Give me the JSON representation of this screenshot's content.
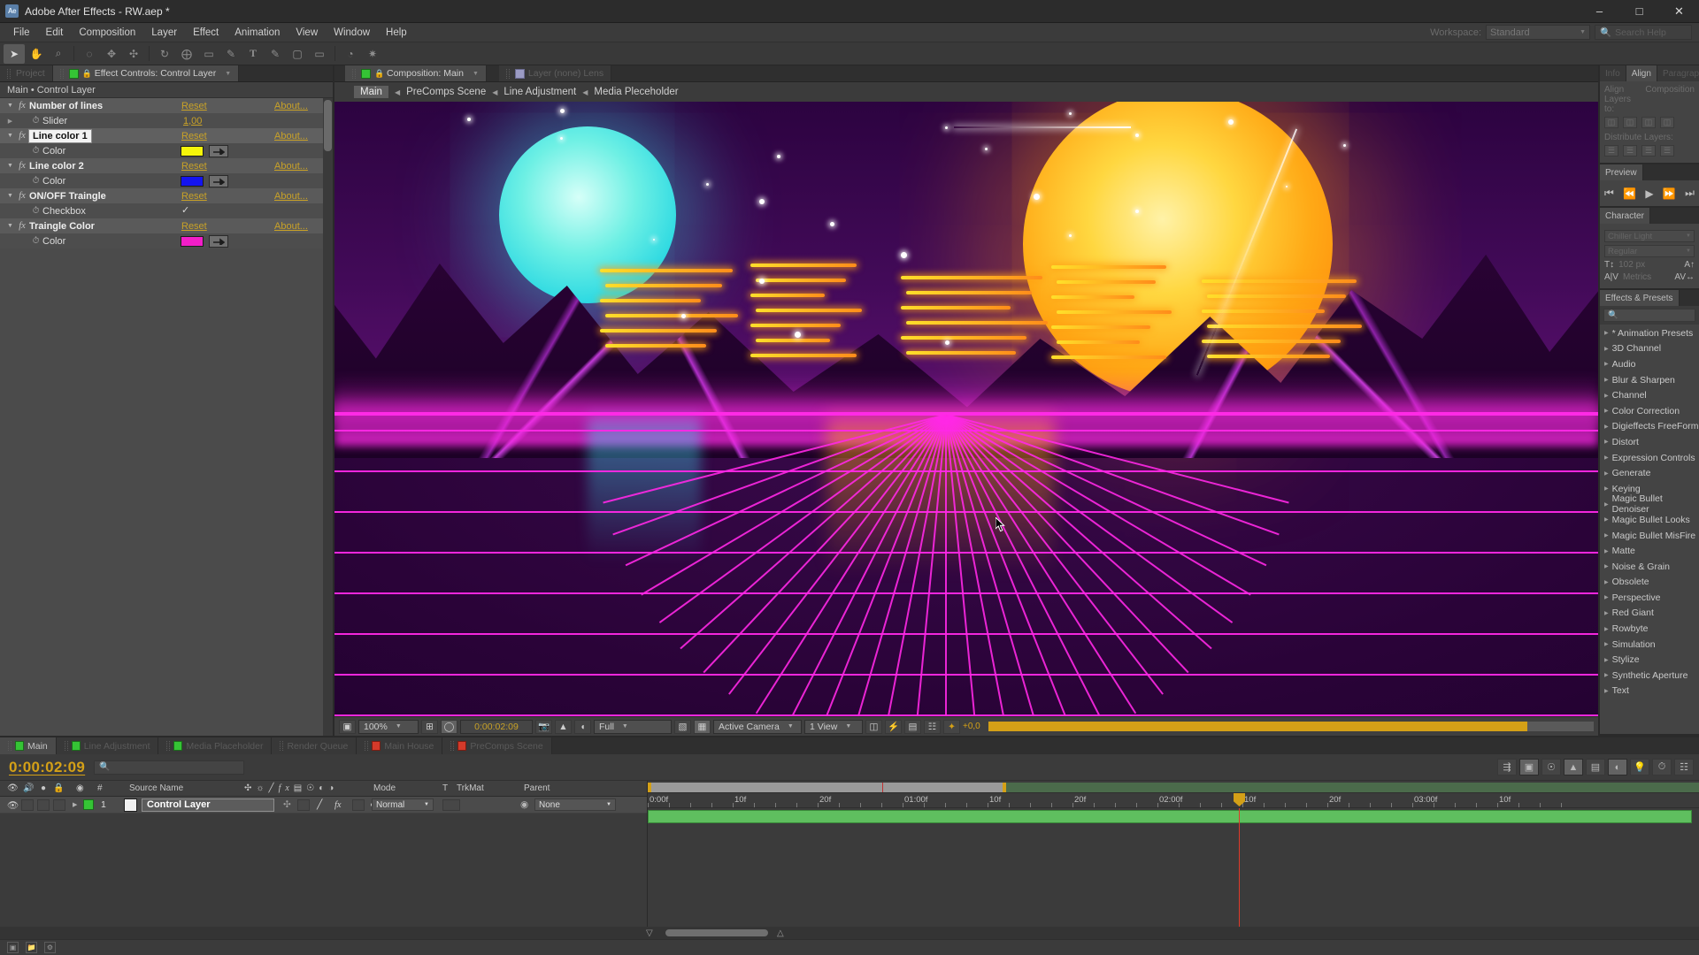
{
  "window": {
    "app_icon": "ae-logo-icon",
    "title": "Adobe After Effects - RW.aep *",
    "minimize": "–",
    "maximize": "□",
    "close": "✕"
  },
  "menu": {
    "items": [
      "File",
      "Edit",
      "Composition",
      "Layer",
      "Effect",
      "Animation",
      "View",
      "Window",
      "Help"
    ],
    "workspace_label": "Workspace:",
    "workspace_value": "Standard",
    "search_placeholder": "Search Help"
  },
  "toolbar": {
    "tools": [
      {
        "name": "selection-tool",
        "glyph": "➤",
        "active": true
      },
      {
        "name": "hand-tool",
        "glyph": "✋",
        "active": false
      },
      {
        "name": "zoom-tool",
        "glyph": "⌕",
        "active": false
      },
      {
        "name": "orbit-camera-tool",
        "glyph": "◌",
        "active": false
      },
      {
        "name": "track-xy-camera-tool",
        "glyph": "✥",
        "active": false
      },
      {
        "name": "track-z-camera-tool",
        "glyph": "✣",
        "active": false
      },
      {
        "name": "rotation-tool",
        "glyph": "↻",
        "active": false
      },
      {
        "name": "anchor-point-tool",
        "glyph": "⨁",
        "active": false
      },
      {
        "name": "shape-tool",
        "glyph": "□",
        "active": false
      },
      {
        "name": "pen-tool",
        "glyph": "✒",
        "active": false
      },
      {
        "name": "type-tool",
        "glyph": "T",
        "active": false
      },
      {
        "name": "brush-tool",
        "glyph": "✎",
        "active": false
      },
      {
        "name": "clone-stamp-tool",
        "glyph": "☂",
        "active": false
      },
      {
        "name": "eraser-tool",
        "glyph": "▭",
        "active": false
      },
      {
        "name": "roto-brush-tool",
        "glyph": "◔",
        "active": false
      },
      {
        "name": "puppet-pin-tool",
        "glyph": "★",
        "active": false
      }
    ]
  },
  "effect_controls": {
    "tabs": [
      {
        "label": "Project",
        "active": false,
        "icon": "none"
      },
      {
        "label": "Effect Controls: Control Layer",
        "active": true,
        "icon": "comp-swatch"
      }
    ],
    "header": "Main • Control Layer",
    "rows": [
      {
        "kind": "group",
        "name": "Number of lines",
        "triangle": "down",
        "reset": "Reset",
        "about": "About...",
        "selected": false
      },
      {
        "kind": "prop",
        "name": "Slider",
        "triangle": "right",
        "value": "1,00"
      },
      {
        "kind": "group",
        "name": "Line color 1",
        "triangle": "down",
        "reset": "Reset",
        "about": "About...",
        "selected": true
      },
      {
        "kind": "prop",
        "name": "Color",
        "triangle": "none",
        "swatch": "#f5f50a"
      },
      {
        "kind": "group",
        "name": "Line color 2",
        "triangle": "down",
        "reset": "Reset",
        "about": "About...",
        "selected": false
      },
      {
        "kind": "prop",
        "name": "Color",
        "triangle": "none",
        "swatch": "#1414ef"
      },
      {
        "kind": "group",
        "name": "ON/OFF Traingle",
        "triangle": "down",
        "reset": "Reset",
        "about": "About...",
        "selected": false
      },
      {
        "kind": "prop",
        "name": "Checkbox",
        "triangle": "none",
        "checked": true
      },
      {
        "kind": "group",
        "name": "Traingle Color",
        "triangle": "down",
        "reset": "Reset",
        "about": "About...",
        "selected": false
      },
      {
        "kind": "prop",
        "name": "Color",
        "triangle": "none",
        "swatch": "#f21ec8"
      }
    ]
  },
  "composition": {
    "tabs": [
      {
        "label": "Composition: Main",
        "active": true
      },
      {
        "label": "Layer (none) Lens",
        "active": false
      }
    ],
    "breadcrumb": [
      "Main",
      "PreComps Scene",
      "Line Adjustment",
      "Media Pleceholder"
    ],
    "viewer_toolbar": {
      "zoom": "100%",
      "timecode": "0:00:02:09",
      "resolution": "Full",
      "camera": "Active Camera",
      "views": "1 View",
      "exposure": "+0,0"
    }
  },
  "right_panels": {
    "align": {
      "tabs": [
        "Info",
        "Align",
        "Paragraph"
      ],
      "active_tab": "Align",
      "align_label": "Align Layers to:",
      "align_target": "Composition",
      "distribute_label": "Distribute Layers:"
    },
    "preview": {
      "tabs": [
        "Preview"
      ],
      "buttons": [
        "first-frame",
        "prev-frame",
        "play",
        "next-frame",
        "last-frame"
      ]
    },
    "character": {
      "tabs": [
        "Character"
      ],
      "font_family": "Chiller Light",
      "font_style": "Regular",
      "font_size": "102 px",
      "tracking": "Metrics"
    },
    "effects_presets": {
      "tabs": [
        "Effects & Presets"
      ],
      "search_placeholder": "",
      "categories": [
        "* Animation Presets",
        "3D Channel",
        "Audio",
        "Blur & Sharpen",
        "Channel",
        "Color Correction",
        "Digieffects FreeForm",
        "Distort",
        "Expression Controls",
        "Generate",
        "Keying",
        "Magic Bullet Denoiser",
        "Magic Bullet Looks",
        "Magic Bullet MisFire",
        "Matte",
        "Noise & Grain",
        "Obsolete",
        "Perspective",
        "Red Giant",
        "Rowbyte",
        "Simulation",
        "Stylize",
        "Synthetic Aperture",
        "Text"
      ]
    }
  },
  "timeline": {
    "tabs": [
      {
        "label": "Main",
        "active": true,
        "dot": "green"
      },
      {
        "label": "Line Adjustment",
        "active": false,
        "dot": "green"
      },
      {
        "label": "Media Placeholder",
        "active": false,
        "dot": "green"
      },
      {
        "label": "Render Queue",
        "active": false,
        "dot": "none"
      },
      {
        "label": "Main House",
        "active": false,
        "dot": "red"
      },
      {
        "label": "PreComps Scene",
        "active": false,
        "dot": "red"
      }
    ],
    "timecode": "0:00:02:09",
    "search_placeholder": "",
    "switches": [
      "live-update",
      "draft-3d",
      "hide-shy",
      "graph-editor",
      "motion-blur",
      "frame-blend",
      "brainstorm",
      "auto-keyframe",
      "solo-switch"
    ],
    "columns": [
      "#",
      "Source Name",
      "Mode",
      "T",
      "TrkMat",
      "Parent"
    ],
    "layers": [
      {
        "index": "1",
        "name": "Control Layer",
        "renaming": true,
        "mode": "Normal",
        "trkmat": "",
        "parent": "None",
        "label_color": "#b8b8b8",
        "video_on": true
      }
    ],
    "ruler_labels": [
      "0:00f",
      "10f",
      "20f",
      "01:00f",
      "10f",
      "20f",
      "02:00f",
      "10f",
      "20f",
      "03:00f",
      "10f"
    ]
  },
  "artwork": {
    "description": "retrowave neon synthwave landscape",
    "colors": {
      "sky_top": "#2c0340",
      "sky_bottom": "#5c1070",
      "grid": "#ff28e6",
      "sun": "#ffa916",
      "moon": "#2ad8e2",
      "neon_yellow": "#ffdf2a",
      "neon_orange": "#ff8c1a"
    }
  }
}
